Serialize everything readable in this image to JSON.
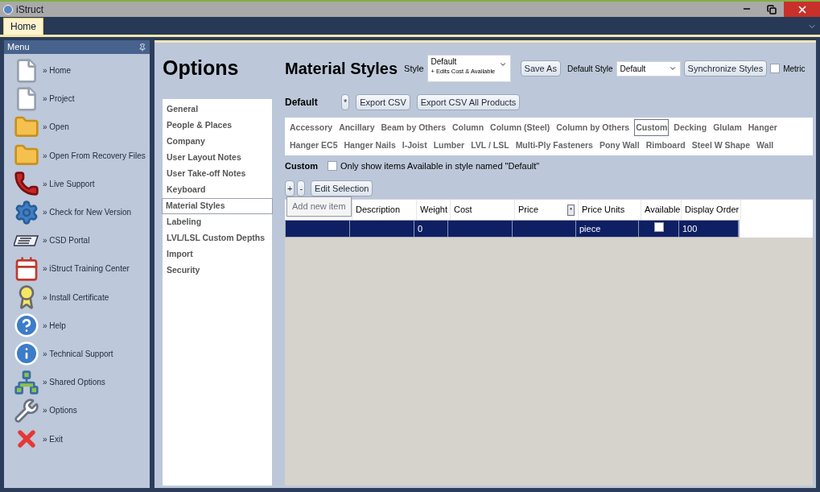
{
  "window": {
    "title": "iStruct"
  },
  "ribbon_tabs": [
    {
      "label": "Home",
      "selected": true
    }
  ],
  "menu": {
    "title": "Menu",
    "items": [
      {
        "label": "» Home"
      },
      {
        "label": "» Project"
      },
      {
        "label": "» Open"
      },
      {
        "label": "» Open From Recovery Files"
      },
      {
        "label": "» Live Support"
      },
      {
        "label": "» Check for New Version"
      },
      {
        "label": "» CSD Portal"
      },
      {
        "label": "» iStruct Training Center"
      },
      {
        "label": "» Install Certificate"
      },
      {
        "label": "» Help"
      },
      {
        "label": "» Technical Support"
      },
      {
        "label": "» Shared Options"
      },
      {
        "label": "» Options"
      },
      {
        "label": "» Exit"
      }
    ]
  },
  "options": {
    "title": "Options",
    "items": [
      {
        "label": "General",
        "selected": false
      },
      {
        "label": "People & Places",
        "selected": false
      },
      {
        "label": "Company",
        "selected": false
      },
      {
        "label": "User Layout Notes",
        "selected": false
      },
      {
        "label": "User Take-off Notes",
        "selected": false
      },
      {
        "label": "Keyboard",
        "selected": false
      },
      {
        "label": "Material Styles",
        "selected": true
      },
      {
        "label": "Labeling",
        "selected": false
      },
      {
        "label": "LVL/LSL Custom Depths",
        "selected": false
      },
      {
        "label": "Import",
        "selected": false
      },
      {
        "label": "Security",
        "selected": false
      }
    ]
  },
  "material_styles": {
    "title": "Material Styles",
    "style_label": "Style",
    "style_value": "Default",
    "style_note": "+ Edits Cost & Available",
    "save_as": "Save As",
    "default_style_label": "Default Style",
    "default_style_value": "Default",
    "synchronize": "Synchronize Styles",
    "metric": {
      "label": "Metric",
      "checked": false
    },
    "style_name": "Default",
    "star_button": "*",
    "export_csv": "Export CSV",
    "export_all": "Export CSV All Products"
  },
  "categories": [
    {
      "label": "Accessory",
      "selected": false
    },
    {
      "label": "Ancillary",
      "selected": false
    },
    {
      "label": "Beam by Others",
      "selected": false
    },
    {
      "label": "Column",
      "selected": false
    },
    {
      "label": "Column (Steel)",
      "selected": false
    },
    {
      "label": "Column by Others",
      "selected": false
    },
    {
      "label": "Custom",
      "selected": true
    },
    {
      "label": "Decking",
      "selected": false
    },
    {
      "label": "Glulam",
      "selected": false
    },
    {
      "label": "Hanger",
      "selected": false
    },
    {
      "label": "Hanger EC5",
      "selected": false
    },
    {
      "label": "Hanger Nails",
      "selected": false
    },
    {
      "label": "I-Joist",
      "selected": false
    },
    {
      "label": "Lumber",
      "selected": false
    },
    {
      "label": "LVL / LSL",
      "selected": false
    },
    {
      "label": "Multi-Ply Fasteners",
      "selected": false
    },
    {
      "label": "Pony Wall",
      "selected": false
    },
    {
      "label": "Rimboard",
      "selected": false
    },
    {
      "label": "Steel W Shape",
      "selected": false
    },
    {
      "label": "Wall",
      "selected": false
    }
  ],
  "filter": {
    "section": "Custom",
    "label": "Only show items Available in style named \"Default\"",
    "checked": false
  },
  "toolbar": {
    "add": "+",
    "remove": "-",
    "edit": "Edit Selection",
    "tooltip": "Add new item"
  },
  "table": {
    "columns": [
      {
        "label": "Description"
      },
      {
        "label": "Weight"
      },
      {
        "label": "Cost"
      },
      {
        "label": "Price",
        "button": "*"
      },
      {
        "label": "Price Units"
      },
      {
        "label": "Available"
      },
      {
        "label": "Display Order"
      }
    ],
    "rows": [
      {
        "selected": true,
        "weight": "0",
        "price_units": "piece",
        "available": false,
        "display_order": "100"
      }
    ]
  }
}
